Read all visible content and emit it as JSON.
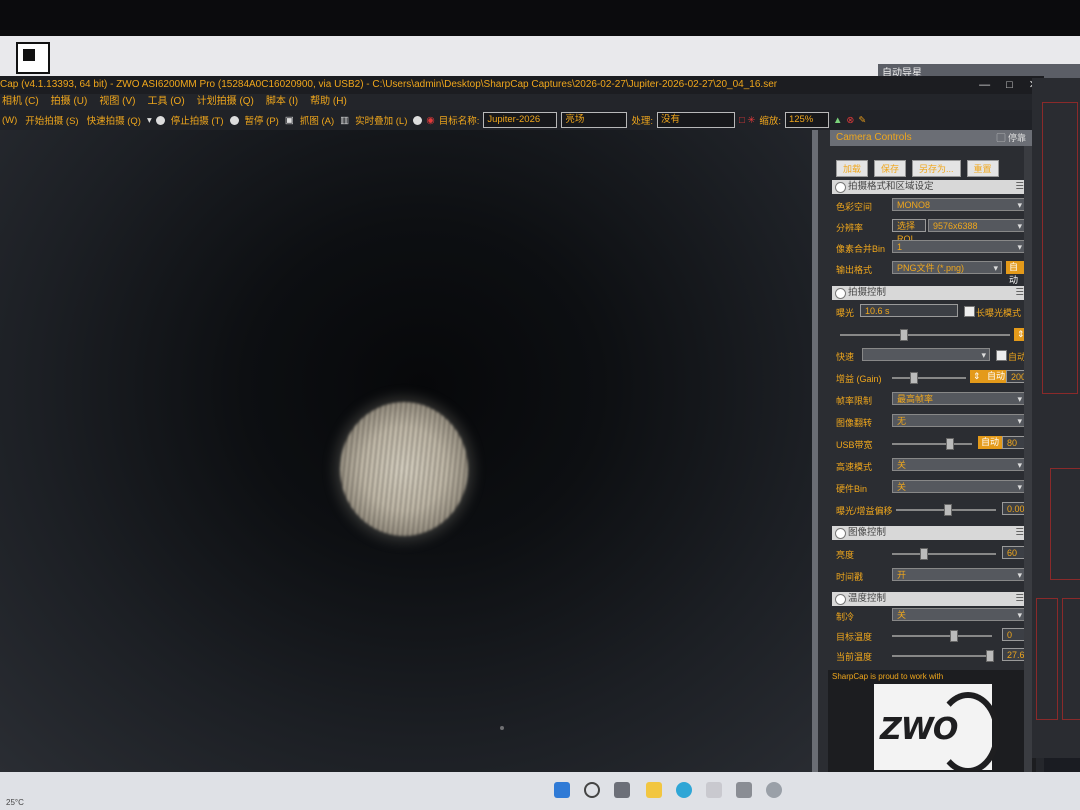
{
  "window": {
    "title": "Cap (v4.1.13393, 64 bit) - ZWO ASI6200MM Pro (15284A0C16020900, via USB2) - C:\\Users\\admin\\Desktop\\SharpCap Captures\\2026-02-27\\Jupiter-2026-02-27\\20_04_16.ser",
    "controls": [
      "—",
      "□",
      "✕"
    ]
  },
  "behind_window_title": "自动导星",
  "menu": [
    "相机 (C)",
    "拍摄 (U)",
    "视图 (V)",
    "工具 (O)",
    "计划拍摄 (Q)",
    "脚本 (I)",
    "帮助 (H)"
  ],
  "toolbar": {
    "w_label": "(W)",
    "start_capture": "开始拍摄 (S)",
    "quick_capture": "快速拍摄 (Q)",
    "stop_capture": "停止拍摄 (T)",
    "pause": "暂停 (P)",
    "snapshot": "抓图 (A)",
    "live_stack": "实时叠加 (L)",
    "target_label": "目标名称:",
    "target_value": "Jupiter-2026",
    "profile_value": "亮场",
    "process_label": "处理:",
    "process_value": "没有",
    "zoom_label": "缩放:",
    "zoom_value": "125%"
  },
  "panel": {
    "title": "Camera Controls",
    "pin_label": "▢ 停靠",
    "buttons": [
      "加载",
      "保存",
      "另存为...",
      "重置"
    ],
    "sections": {
      "capture_format": {
        "title": "拍摄格式和区域设定",
        "color_space_label": "色彩空间",
        "color_space_value": "MONO8",
        "resolution_label": "分辨率",
        "resolution_button": "选择ROI",
        "resolution_value": "9576x6388",
        "binning_label": "像素合并Bin",
        "binning_value": "1",
        "output_label": "输出格式",
        "output_value": "PNG文件 (*.png)",
        "output_auto": "自动"
      },
      "capture_control": {
        "title": "拍摄控制",
        "exposure_label": "曝光",
        "exposure_value": "10.6 s",
        "long_exposure_label": "长曝光模式",
        "quick_label": "快速",
        "auto_label": "自动",
        "gain_label": "增益 (Gain)",
        "gain_auto": "自动",
        "gain_value": "200",
        "frame_limit_label": "帧率限制",
        "frame_limit_value": "最高帧率",
        "flip_label": "图像翻转",
        "flip_value": "无",
        "usb_label": "USB带宽",
        "usb_auto": "自动",
        "usb_value": "80",
        "highspeed_label": "高速模式",
        "highspeed_value": "关",
        "hwbin_label": "硬件Bin",
        "hwbin_value": "关",
        "offset_label": "曝光/增益偏移",
        "offset_value": "0.00"
      },
      "image_control": {
        "title": "图像控制",
        "brightness_label": "亮度",
        "brightness_value": "60",
        "timestamp_label": "时间戳",
        "timestamp_value": "开"
      },
      "temperature_control": {
        "title": "温度控制",
        "cooler_label": "制冷",
        "cooler_value": "关",
        "target_temp_label": "目标温度",
        "target_temp_value": "0",
        "current_temp_label": "当前温度",
        "current_temp_value": "27.6"
      }
    },
    "promo_text": "SharpCap is proud to work with",
    "logo_text": "ZWO"
  },
  "taskbar": {
    "weather": "25°C"
  }
}
